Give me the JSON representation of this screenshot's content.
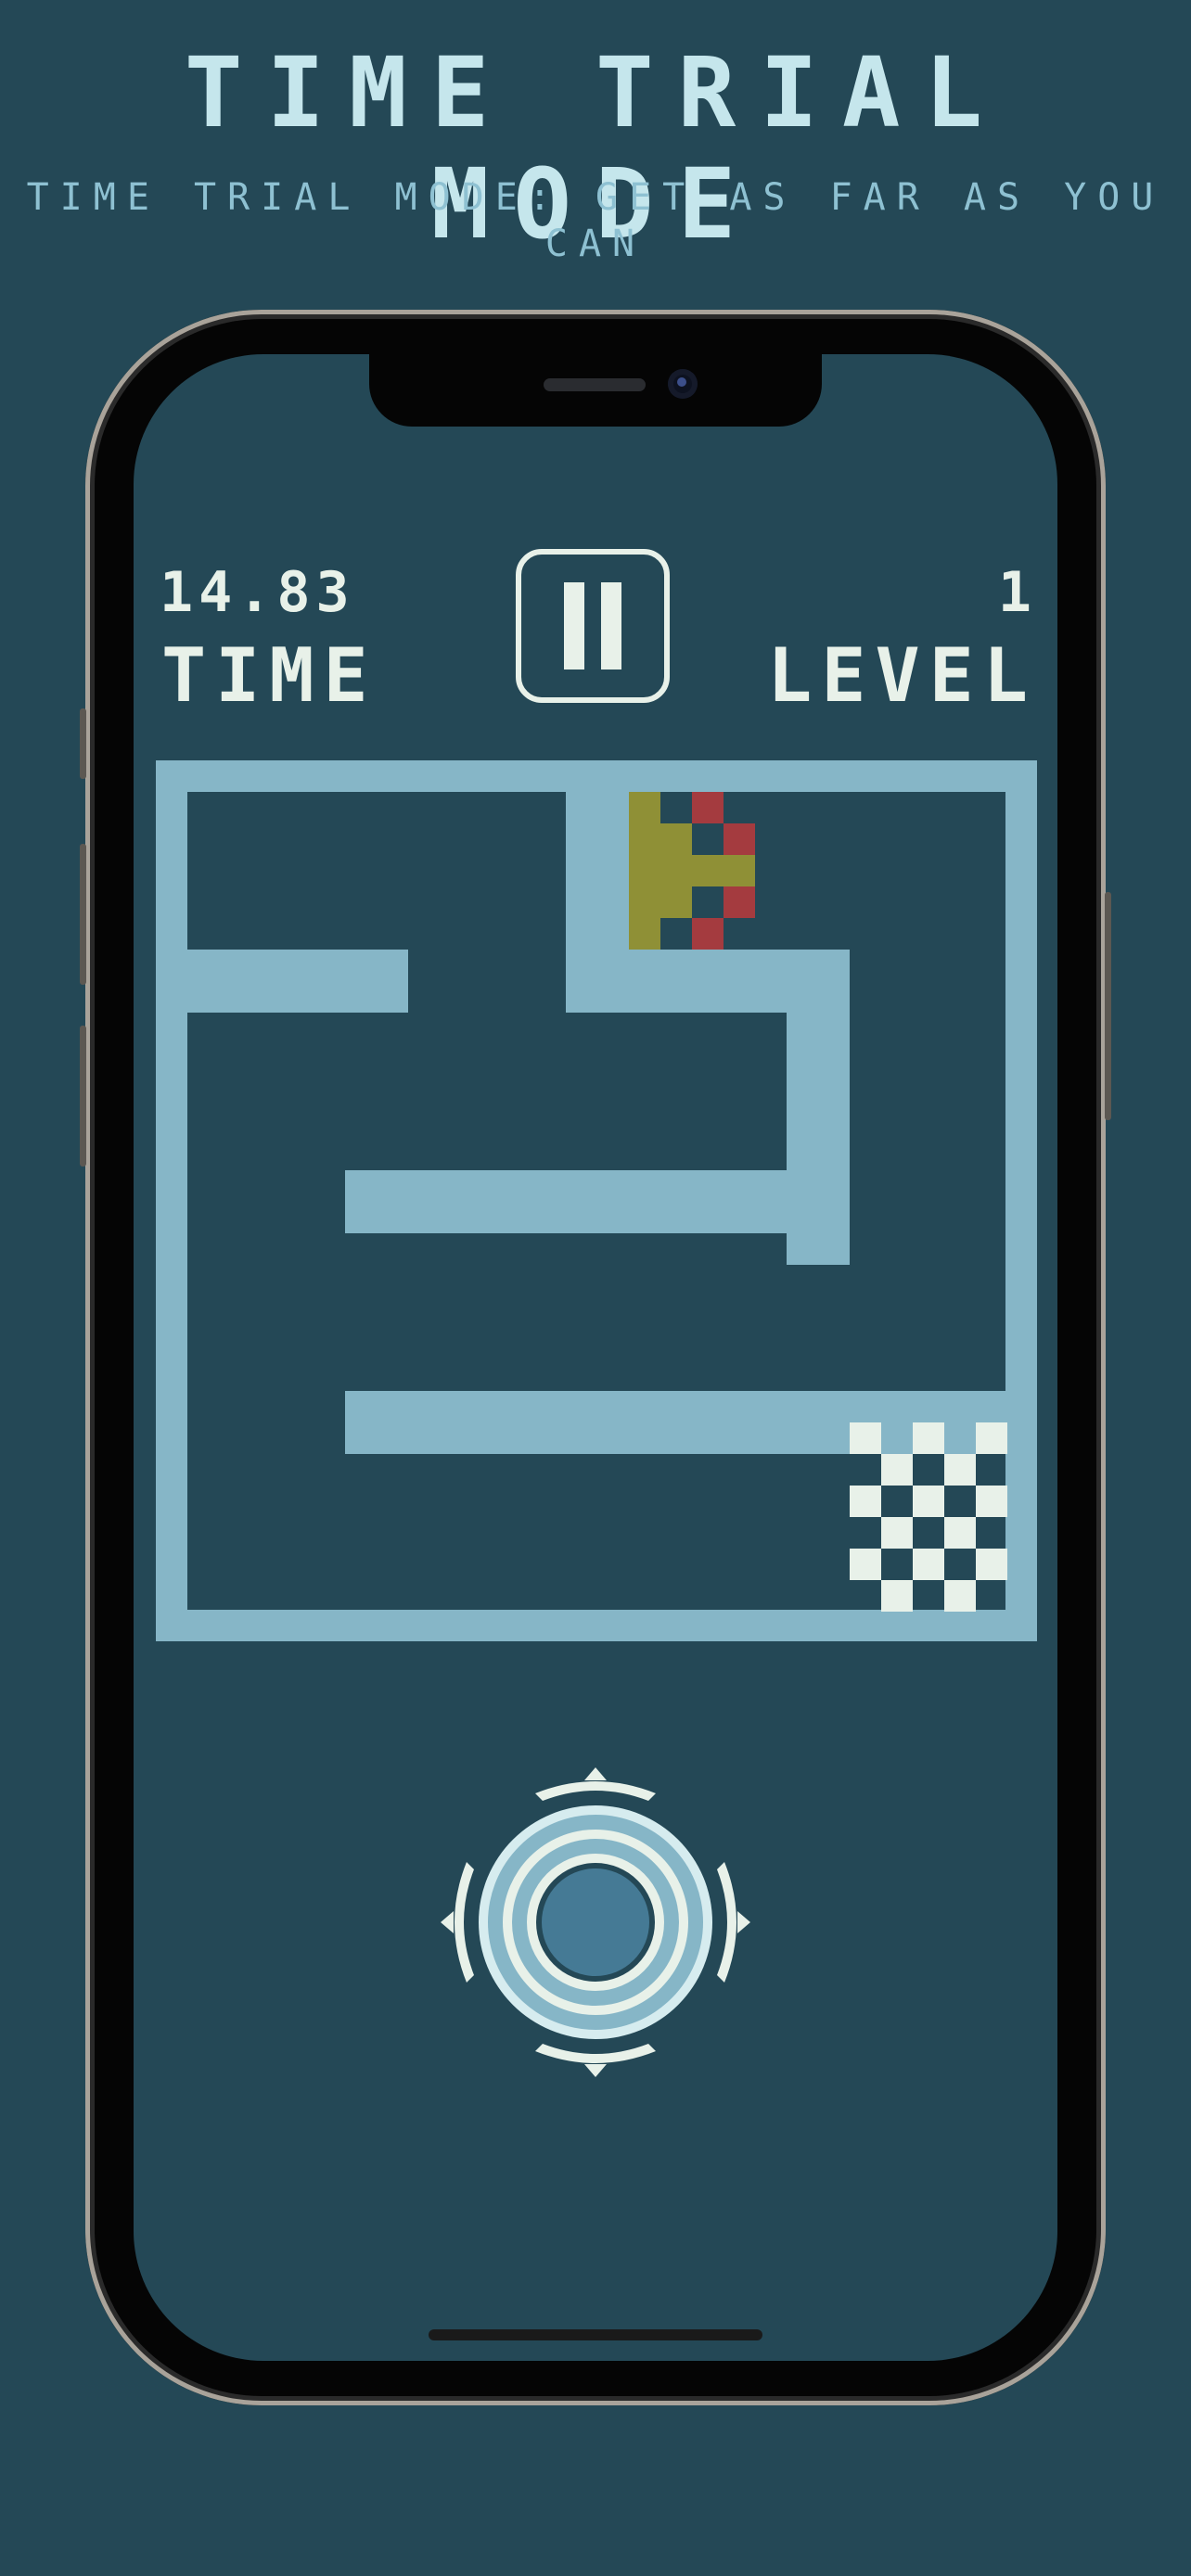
{
  "header": {
    "title": "TIME TRIAL MODE",
    "subtitle": "TIME TRIAL MODE: GET AS FAR AS YOU CAN"
  },
  "hud": {
    "time_value": "14.83",
    "time_label": "TIME",
    "level_value": "1",
    "level_label": "LEVEL",
    "pause_icon": "pause-icon"
  },
  "colors": {
    "background": "#244856",
    "wall": "#86b6c7",
    "text": "#e8f1e9",
    "title": "#c5e6ec",
    "player_body": "#8f9036",
    "player_flame": "#a43b3f",
    "goal_checker": "#e8f1e9"
  },
  "game": {
    "player_icon": "rocket-ship-icon",
    "goal_icon": "checkered-flag-icon",
    "control_icon": "joystick-icon"
  }
}
